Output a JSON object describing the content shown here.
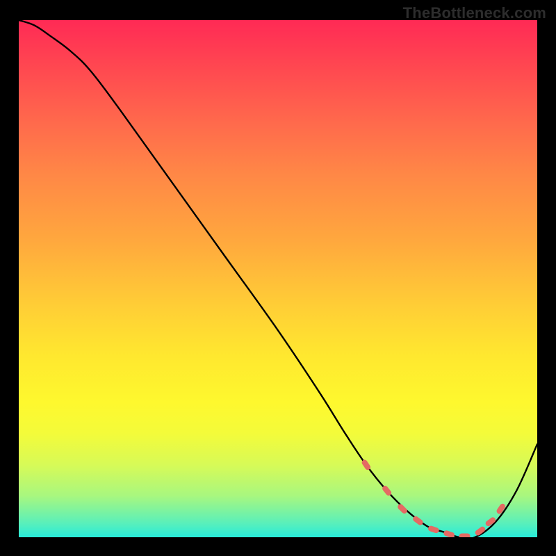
{
  "attribution": "TheBottleneck.com",
  "chart_data": {
    "type": "line",
    "title": "",
    "xlabel": "",
    "ylabel": "",
    "xlim": [
      0,
      100
    ],
    "ylim": [
      0,
      100
    ],
    "series": [
      {
        "name": "bottleneck-curve",
        "x": [
          0,
          3,
          6,
          10,
          14,
          20,
          30,
          40,
          50,
          58,
          63,
          67,
          71,
          75,
          79,
          82,
          85,
          88,
          92,
          96,
          100
        ],
        "y": [
          100,
          99,
          97,
          94,
          90,
          82,
          68,
          54,
          40,
          28,
          20,
          14,
          9,
          5,
          2,
          1,
          0,
          0,
          3,
          9,
          18
        ]
      }
    ],
    "markers": {
      "name": "highlight-dashes",
      "points": [
        {
          "x": 67,
          "y": 14
        },
        {
          "x": 71,
          "y": 9
        },
        {
          "x": 74,
          "y": 5.5
        },
        {
          "x": 77,
          "y": 3.2
        },
        {
          "x": 80,
          "y": 1.5
        },
        {
          "x": 83,
          "y": 0.6
        },
        {
          "x": 86,
          "y": 0.2
        },
        {
          "x": 89,
          "y": 1.2
        },
        {
          "x": 91,
          "y": 3.0
        },
        {
          "x": 93,
          "y": 5.5
        }
      ]
    },
    "colors": {
      "curve": "#000000",
      "marker": "#e46a63",
      "gradient_top": "#ff2a55",
      "gradient_bottom": "#28ecda"
    }
  }
}
